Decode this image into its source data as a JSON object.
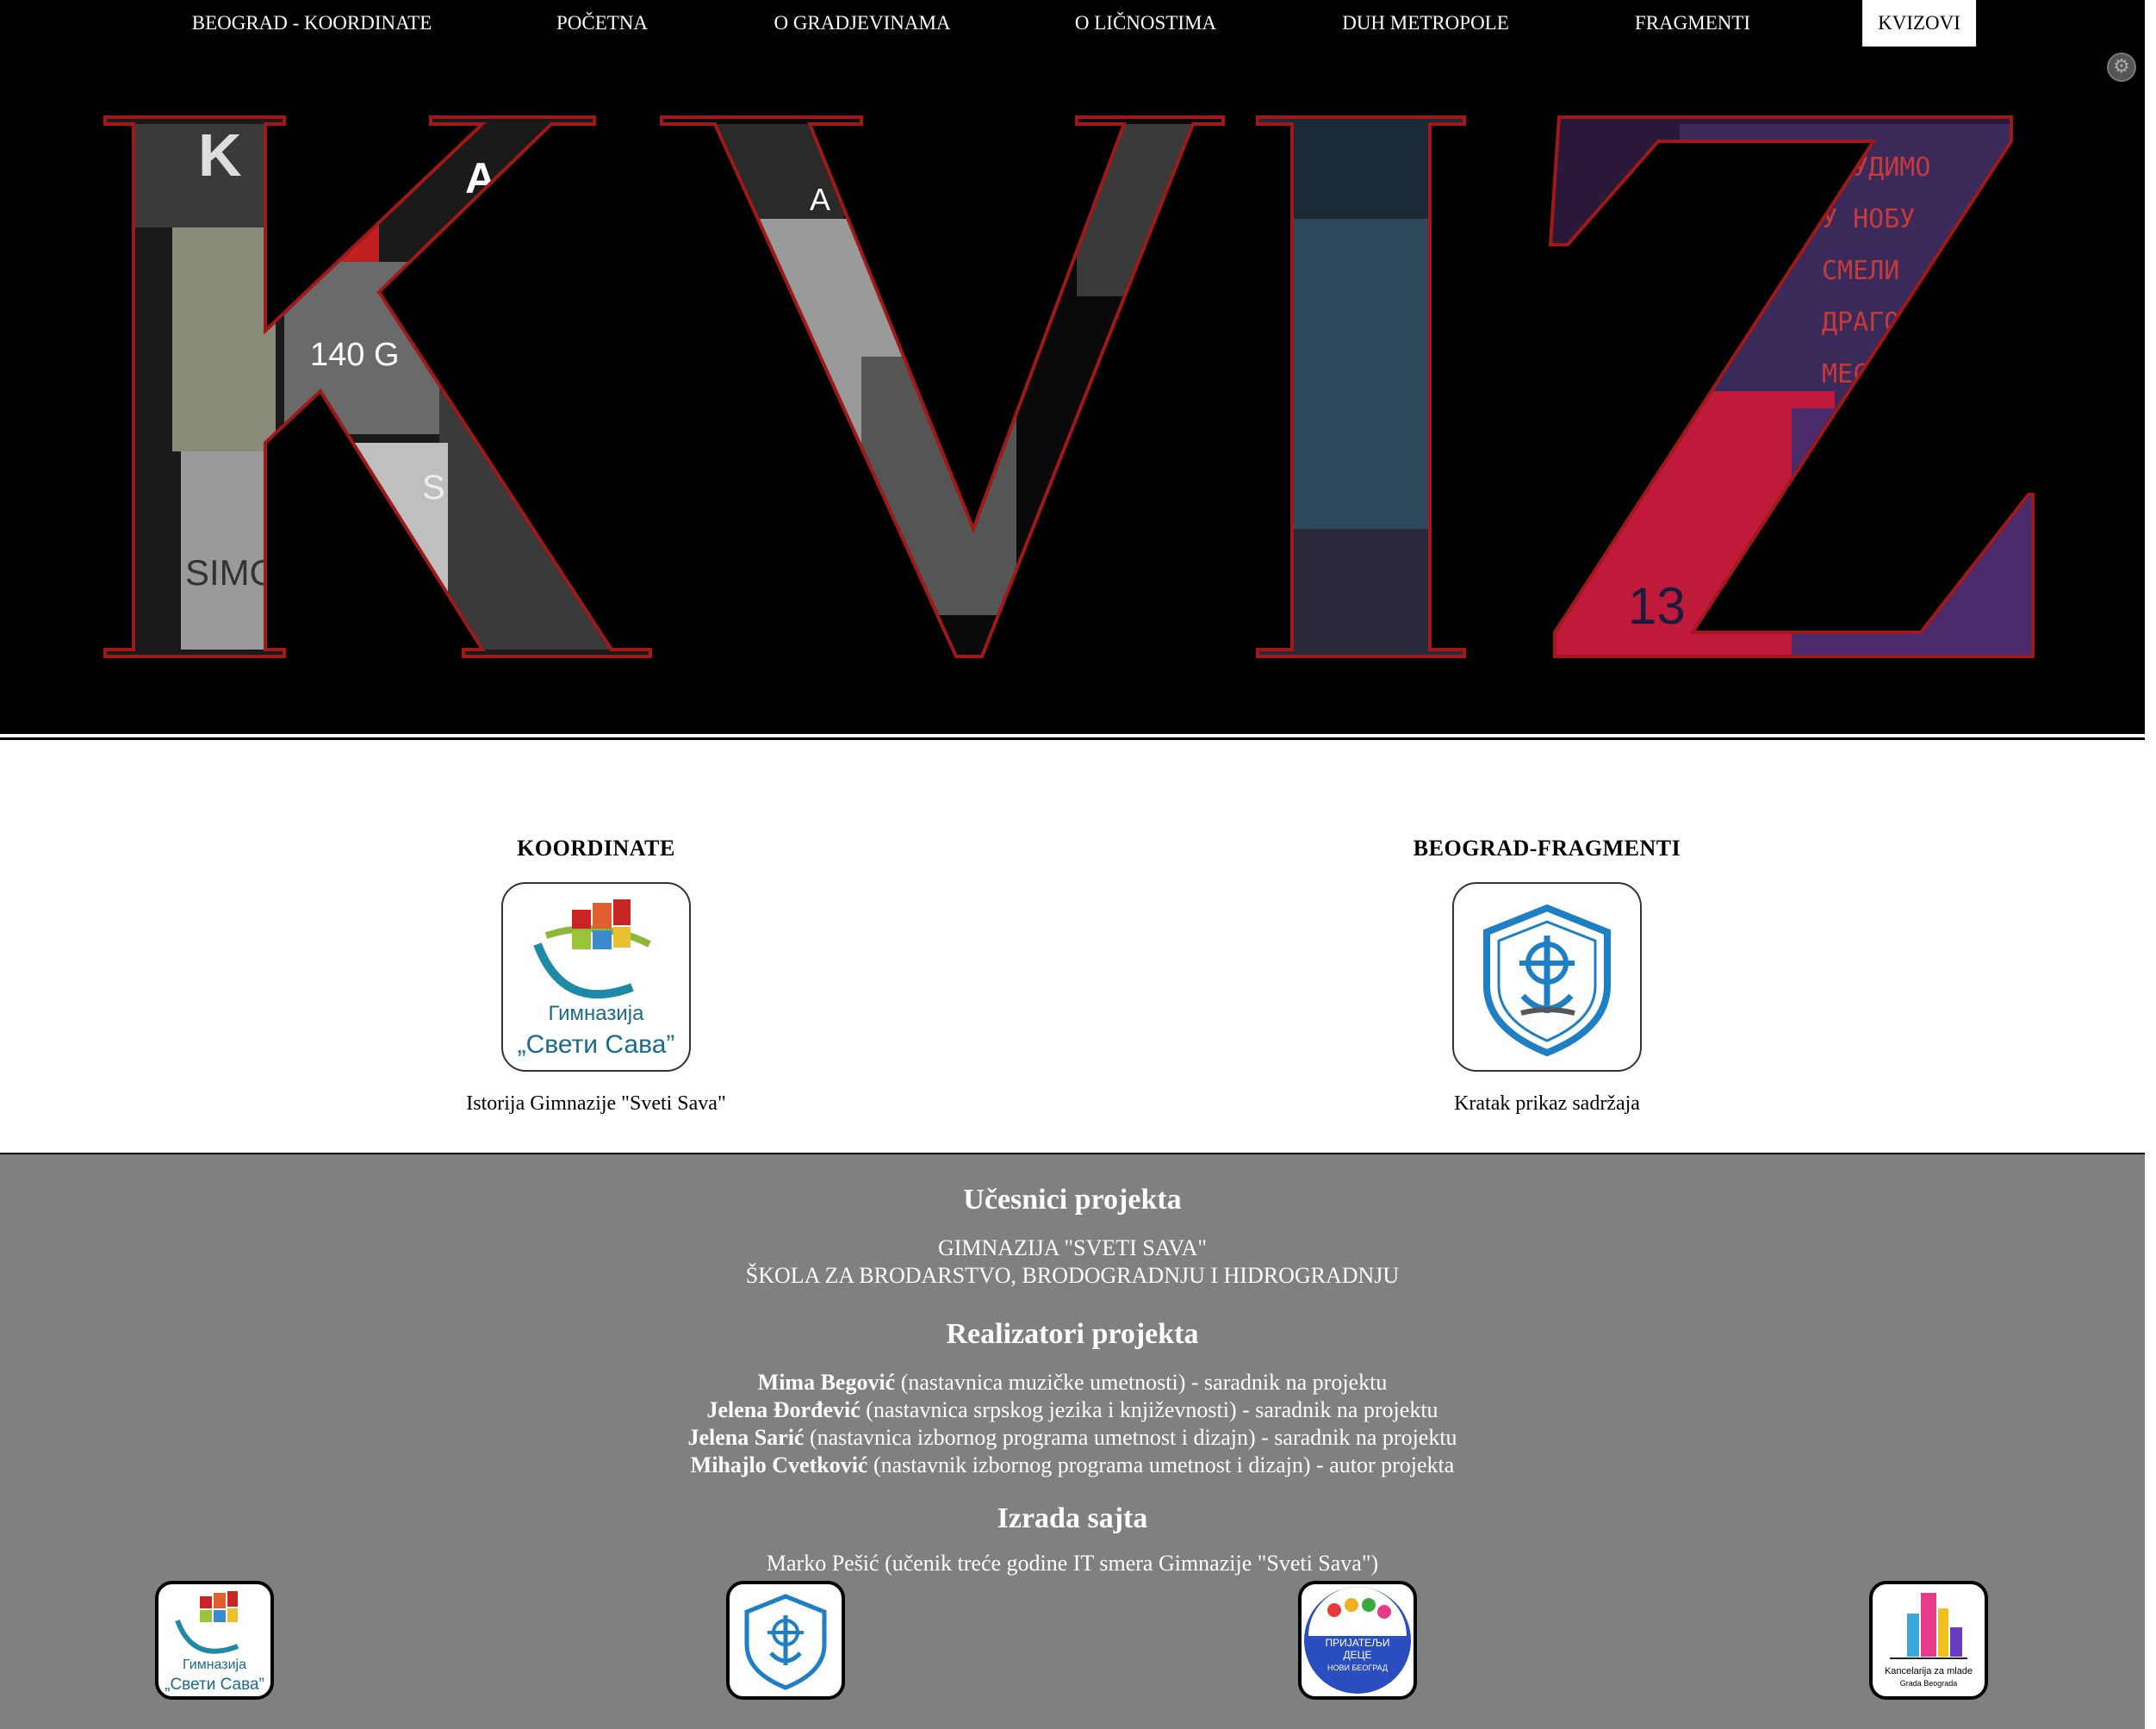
{
  "nav": {
    "items": [
      {
        "label": "BEOGRAD - KOORDINATE"
      },
      {
        "label": "POČETNA"
      },
      {
        "label": "O GRADJEVINAMA"
      },
      {
        "label": "O LIČNOSTIMA"
      },
      {
        "label": "DUH METROPOLE"
      },
      {
        "label": "FRAGMENTI"
      },
      {
        "label": "KVIZOVI",
        "active": true
      }
    ]
  },
  "hero": {
    "title": "KVIZ",
    "collage_texts": [
      "K",
      "A",
      "140 G",
      "S",
      "SIMO",
      "A",
      "ОБУДИМО",
      "У НОБУ",
      "СМЕЛИ",
      "ДРАГО",
      "МЕС",
      "13"
    ],
    "colors": {
      "outline": "#a01818",
      "background": "#000000",
      "tint": "#3a1a4a"
    }
  },
  "cards": [
    {
      "heading": "KOORDINATE",
      "caption": "Istorija Gimnazije \"Sveti Sava\"",
      "logo_lines": [
        "Гимназија",
        "„Свети Сава”"
      ]
    },
    {
      "heading": "BEOGRAD-FRAGMENTI",
      "caption": "Kratak prikaz sadržaja"
    }
  ],
  "footer": {
    "participants_title": "Učesnici projekta",
    "participants": [
      "GIMNAZIJA \"SVETI SAVA\"",
      "ŠKOLA ZA BRODARSTVO, BRODOGRADNJU I HIDROGRADNJU"
    ],
    "realizers_title": "Realizatori projekta",
    "realizers": [
      {
        "name": "Mima Begović",
        "role": "(nastavnica muzičke umetnosti) - saradnik na projektu"
      },
      {
        "name": "Jelena Đorđević",
        "role": "(nastavnica srpskog jezika i književnosti) - saradnik na projektu"
      },
      {
        "name": "Jelena Sarić",
        "role": "(nastavnica izbornog programa umetnost i dizajn) - saradnik na projektu"
      },
      {
        "name": "Mihajlo Cvetković",
        "role": "(nastavnik izbornog programa umetnost i dizajn) - autor projekta"
      }
    ],
    "site_title": "Izrada sajta",
    "site_credit": "Marko Pešić (učenik treće godine IT smera Gimnazije \"Sveti Sava\")",
    "logos": [
      {
        "name": "gimnazija-logo",
        "lines": [
          "Гимназија",
          "„Свети Сава”"
        ]
      },
      {
        "name": "brodarska-logo"
      },
      {
        "name": "prijatelji-dece-logo",
        "lines": [
          "ПРИЈАТЕЉИ",
          "ДЕЦЕ",
          "НОВИ БЕОГРАД"
        ]
      },
      {
        "name": "kancelarija-logo",
        "lines": [
          "Kancelarija za mlade",
          "Grada Beograda"
        ]
      }
    ]
  },
  "colors": {
    "accent_blue": "#1e7fc4",
    "footer_gray": "#808080"
  }
}
